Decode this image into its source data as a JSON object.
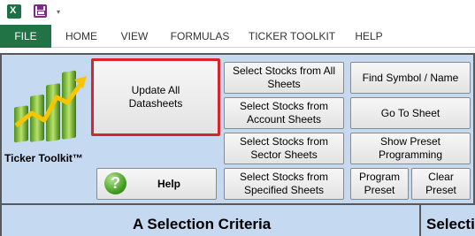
{
  "quick_access": {
    "app_icon": "excel-icon",
    "app_icon_letter": "X",
    "save_icon": "save-icon",
    "more_icon": "customize-qat-icon",
    "more_glyph": "▾"
  },
  "ribbon_tabs": [
    "FILE",
    "HOME",
    "VIEW",
    "FORMULAS",
    "TICKER TOOLKIT",
    "HELP"
  ],
  "panel": {
    "logo_label": "Ticker Toolkit™",
    "buttons": {
      "update_all": "Update All Datasheets",
      "help": "Help",
      "select_all_sheets": "Select Stocks from All Sheets",
      "select_account_sheets": "Select Stocks from Account Sheets",
      "select_sector_sheets": "Select Stocks from Sector Sheets",
      "select_specified_sheets": "Select Stocks from Specified Sheets",
      "find_symbol": "Find Symbol / Name",
      "go_to_sheet": "Go To Sheet",
      "show_preset": "Show Preset Programming",
      "program_preset": "Program Preset",
      "clear_preset": "Clear Preset"
    }
  },
  "sheet_header": {
    "col1_title": "A Selection Criteria",
    "col2_title": "Selecti"
  },
  "colors": {
    "file_tab": "#217346",
    "panel_bg": "#c5d9f1",
    "highlight_border": "#d9232e"
  }
}
